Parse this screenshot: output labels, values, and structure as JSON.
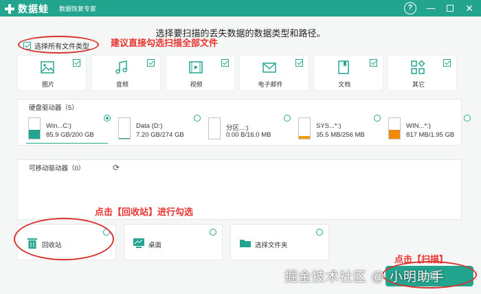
{
  "titlebar": {
    "app_name": "数据蛙",
    "tagline": "数据恢复专家",
    "help": "?",
    "minimize": "—",
    "close": "✕"
  },
  "instruction": "选择要扫描的丢失数据的数据类型和路径。",
  "select_all": {
    "label": "选择所有文件类型",
    "checked": true
  },
  "annotations": {
    "select_all_hint": "建议直接勾选扫描全部文件",
    "recycle_hint": "点击【回收站】进行勾选",
    "scan_hint": "点击【扫描】"
  },
  "file_types": [
    {
      "label": "图片",
      "icon": "image-icon",
      "checked": true
    },
    {
      "label": "音频",
      "icon": "music-icon",
      "checked": true
    },
    {
      "label": "视频",
      "icon": "video-icon",
      "checked": true
    },
    {
      "label": "电子邮件",
      "icon": "mail-icon",
      "checked": true
    },
    {
      "label": "文档",
      "icon": "document-icon",
      "checked": true
    },
    {
      "label": "其它",
      "icon": "other-icon",
      "checked": true
    }
  ],
  "hard_drives": {
    "title": "硬盘驱动器（5）",
    "items": [
      {
        "name": "Win...C:)",
        "size": "85.9 GB/200 GB",
        "fill": 0.43,
        "color": "#23a48f",
        "selected": true
      },
      {
        "name": "Data (D:)",
        "size": "7.20 GB/274 GB",
        "fill": 0.03,
        "color": "#23a48f",
        "selected": false
      },
      {
        "name": "分区...:)",
        "size": "0.00  B/16.0 MB",
        "fill": 0.0,
        "color": "#f39c12",
        "selected": false
      },
      {
        "name": "SYS...*:)",
        "size": "35.5 MB/256 MB",
        "fill": 0.14,
        "color": "#f39c12",
        "selected": false
      },
      {
        "name": "WIN...*:)",
        "size": "817 MB/1.95 GB",
        "fill": 0.42,
        "color": "#f08a0c",
        "selected": false
      }
    ]
  },
  "removable": {
    "title": "可移动驱动器（0）",
    "refresh_icon": "refresh-icon"
  },
  "locations": [
    {
      "label": "回收站",
      "icon": "trash-icon",
      "color": "#23a48f"
    },
    {
      "label": "桌面",
      "icon": "desktop-icon",
      "color": "#23a48f"
    },
    {
      "label": "选择文件夹",
      "icon": "folder-icon",
      "color": "#23a48f"
    }
  ],
  "scan_button": "扫描",
  "watermark": "掘金技术社区 @ 小明助手"
}
